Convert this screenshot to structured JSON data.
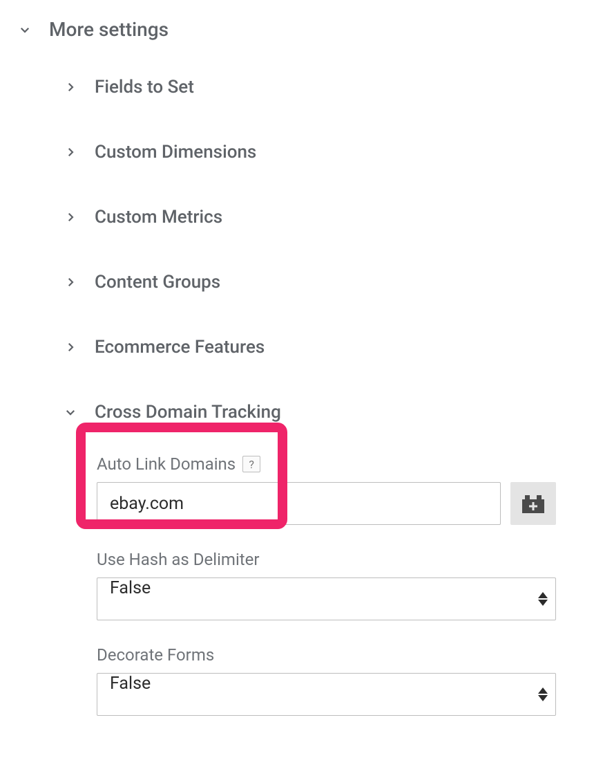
{
  "main": {
    "title": "More settings"
  },
  "sections": {
    "fields_to_set": "Fields to Set",
    "custom_dimensions": "Custom Dimensions",
    "custom_metrics": "Custom Metrics",
    "content_groups": "Content Groups",
    "ecommerce_features": "Ecommerce Features",
    "cross_domain_tracking": "Cross Domain Tracking"
  },
  "cross_domain": {
    "auto_link_domains_label": "Auto Link Domains",
    "auto_link_domains_value": "ebay.com",
    "help_symbol": "?",
    "use_hash_label": "Use Hash as Delimiter",
    "use_hash_value": "False",
    "decorate_forms_label": "Decorate Forms",
    "decorate_forms_value": "False"
  },
  "colors": {
    "highlight": "#ef2469"
  }
}
